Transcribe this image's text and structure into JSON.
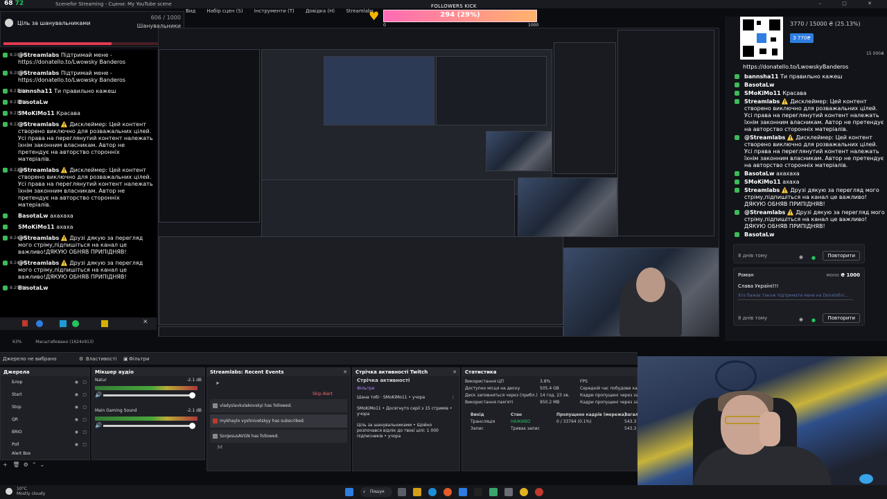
{
  "topbar": {
    "fps_a": "68",
    "fps_b": "72",
    "title": "Scenefor Streaming - Сцени: My YouTube scene",
    "window_buttons": "– ▢ ✕"
  },
  "follower_goal": {
    "label": "Ціль за шанувальниками",
    "count": "606 / 1000",
    "sublabel": "Шанувальники",
    "progress": 0.606
  },
  "obs_menu": {
    "items": [
      "Вид",
      "Набір сцен (S)",
      "Інструменти (T)",
      "Довідка (H)",
      "Streamlabs"
    ]
  },
  "kick_goal": {
    "caption": "FOLLOWERS KICK",
    "value": "294 (29%)",
    "min": "0",
    "max": "1000",
    "progress": 0.294
  },
  "chat": {
    "messages": [
      {
        "time": "8:20 PM",
        "user": "@Streamlabs",
        "text": "Підтримай мене - https://donatello.to/Lwowsky Banderos"
      },
      {
        "time": "8:20 PM",
        "user": "@Streamlabs",
        "text": "Підтримай мене - https://donatello.to/Lwowsky Banderos"
      },
      {
        "time": "8:21 PM",
        "user": "bannsha11",
        "text": "Ти правильно кажеш"
      },
      {
        "time": "8:21 PM",
        "user": "BasotaLw",
        "text": ""
      },
      {
        "time": "8:21 PM",
        "user": "SMoKiMo11",
        "text": "Красава"
      },
      {
        "time": "8:22 PM",
        "user": "@Streamlabs",
        "text": "⚠️ Дисклеймер: Цей контент створено виключно для розважальних цілей. Усі права на переглянутий контент належать їхнім законним власникам. Автор не претендує на авторство сторонніх матеріалів."
      },
      {
        "time": "8:22 PM",
        "user": "@Streamlabs",
        "text": "⚠️ Дисклеймер: Цей контент створено виключно для розважальних цілей. Усі права на переглянутий контент належать їхнім законним власникам. Автор не претендує на авторство сторонніх матеріалів."
      },
      {
        "time": "",
        "user": "BasotaLw",
        "text": "ахахаха"
      },
      {
        "time": "",
        "user": "SMoKiMo11",
        "text": "ахаха"
      },
      {
        "time": "8:24 PM",
        "user": "@Streamlabs",
        "text": "⚠️ Друзі дякую за перегляд мого стріму,підпишіться на канал це важливо!ДЯКУЮ ОБНЯВ ПРИПІДНЯВ!"
      },
      {
        "time": "8:24 PM",
        "user": "@Streamlabs",
        "text": "⚠️ Друзі дякую за перегляд мого стріму,підпишіться на канал це важливо!ДЯКУЮ ОБНЯВ ПРИПІДНЯВ!"
      },
      {
        "time": "8:25 PM",
        "user": "BasotaLw",
        "text": ""
      }
    ]
  },
  "zoom": {
    "value": "63%",
    "label": "Масштабовано (1624x913)"
  },
  "source_toolbar": {
    "no_source": "Джерело не вибрано",
    "properties": "Властивості",
    "filters": "Фільтри"
  },
  "sources_dock": {
    "title": "Джерела",
    "items": [
      "Блор",
      "Start",
      "Stop",
      "QR",
      "BRIO",
      "Poll",
      "Alert Box"
    ]
  },
  "mixer_dock": {
    "title": "Мікшер аудіо",
    "channels": [
      {
        "name": "Natur",
        "db": "-2.1 dB"
      },
      {
        "name": "Main Gaming Sound",
        "db": "-2.1 dB"
      }
    ]
  },
  "events_dock": {
    "title": "Streamlabs: Recent Events",
    "skip": "Skip Alert",
    "events": [
      {
        "text": "vladyslavkulakovskyi has followed."
      },
      {
        "text": "mykhaylo vyshnivetskyy has subscribed."
      },
      {
        "text": "SonJesusAVGN has followed."
      }
    ],
    "footer": "3d"
  },
  "activity_dock": {
    "title": "Стрічка активності Twitch",
    "subtitle": "Стрічка активності",
    "filters": "Фільтри",
    "items": [
      {
        "text": "Шана тобі · SMoKiMo11 • учора"
      },
      {
        "text": "SMoKiMo11 • Досягнуто серії з 15 стримів • учора"
      },
      {
        "text": "Ціль за шанувальниками • Щойно розпочався відлік до твоєї цілі: 1 000 підписників • учора"
      }
    ]
  },
  "stats_dock": {
    "title": "Статистика",
    "rows": [
      {
        "k": "Використання ЦП",
        "v": "3.8%",
        "k2": "FPS"
      },
      {
        "k": "Доступно місця на диску",
        "v": "505.4 GB",
        "k2": "Середній час побудови кадру"
      },
      {
        "k": "Диск заповниться через (прибл.)",
        "v": "14 год. 23 хв.",
        "k2": "Кадри пропущені через затримку"
      },
      {
        "k": "Використання пам'яті",
        "v": "950.2 MB",
        "k2": "Кадри пропущені через затримку"
      }
    ],
    "head": [
      "Вихід",
      "Стан",
      "Пропущено кадрів (мережа)",
      "Загалом"
    ],
    "out_rows": [
      {
        "a": "Трансляція",
        "b": "НАЖИВО",
        "c": "0 / 33764 (0.1%)",
        "d": "543.3"
      },
      {
        "a": "Запис",
        "b": "Триває запис",
        "c": "",
        "d": "543.3"
      }
    ]
  },
  "donation_panel": {
    "value": "3770 / 15000 ₴ (25.13%)",
    "button": "3 770₴",
    "max": "15 000₴",
    "url": "https://donatello.to/LwowskyBanderos",
    "messages": [
      {
        "user": "bannsha11",
        "text": "Ти правильно кажеш"
      },
      {
        "user": "BasotaLw",
        "text": ""
      },
      {
        "user": "SMoKiMo11",
        "text": "Красава"
      },
      {
        "user": "Streamlabs",
        "text": "⚠️ Дисклеймер: Цей контент створено виключно для розважальних цілей. Усі права на переглянутий контент належать їхнім законним власникам. Автор не претендує на авторство сторонніх матеріалів."
      },
      {
        "user": "@Streamlabs",
        "text": "⚠️ Дисклеймер: Цей контент створено виключно для розважальних цілей. Усі права на переглянутий контент належать їхнім законним власникам. Автор не претендує на авторство сторонніх матеріалів."
      },
      {
        "user": "BasotaLw",
        "text": "ахахаха"
      },
      {
        "user": "SMoKiMo11",
        "text": "ахаха"
      },
      {
        "user": "Streamlabs",
        "text": "⚠️ Друзі дякую за перегляд мого стріму,підпишіться на канал це важливо! ДЯКУЮ ОБНЯВ ПРИПІДНЯВ!"
      },
      {
        "user": "@Streamlabs",
        "text": "⚠️ Друзі дякую за перегляд мого стріму,підпишіться на канал це важливо! ДЯКУЮ ОБНЯВ ПРИПІДНЯВ!"
      },
      {
        "user": "BasotaLw",
        "text": ""
      }
    ],
    "repeat": "Повторити",
    "card1": {
      "when": "8 днів тому"
    },
    "card2": {
      "name": "Роман",
      "amount_label": "моно",
      "amount": "₴ 1000",
      "body": "Слава Україні!!!",
      "hint": "Хто бажає також підтримати мене на Donatello!...",
      "when": "8 днів тому"
    }
  },
  "taskbar": {
    "weather_temp": "10°C",
    "weather_desc": "Mostly cloudy",
    "search": "Пошук"
  },
  "colors": {
    "accent_red": "#e23a52",
    "kick_pink": "#ff6bb5",
    "twitch_green": "#3dbb5a",
    "live_green": "#22c55e",
    "dona_blue": "#2e7de0"
  }
}
